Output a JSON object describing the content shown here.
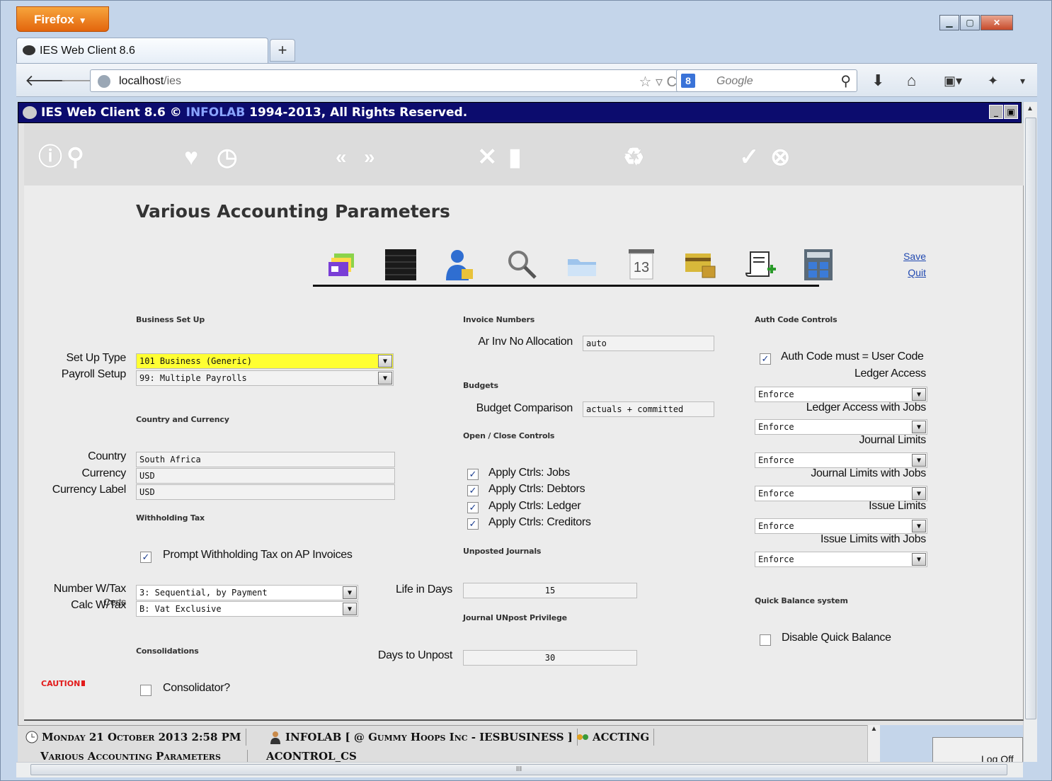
{
  "browser": {
    "menu_label": "Firefox",
    "tab_title": "IES Web Client 8.6",
    "new_tab": "+",
    "url_host": "localhost",
    "url_path": "/ies",
    "search_engine": "8",
    "search_placeholder": "Google"
  },
  "app": {
    "title_pre": "IES Web Client 8.6 © ",
    "title_brand": "INFOLAB",
    "title_post": " 1994-2013, All Rights Reserved.",
    "page_title": "Various Accounting Parameters",
    "save": "Save",
    "quit": "Quit"
  },
  "business": {
    "heading": "Business Set Up",
    "setup_type_label": "Set Up Type",
    "setup_type_value": "101 Business (Generic)",
    "payroll_label": "Payroll Setup",
    "payroll_value": "99: Multiple Payrolls"
  },
  "country": {
    "heading": "Country and Currency",
    "country_label": "Country",
    "country_value": "South Africa",
    "currency_label": "Currency",
    "currency_value": "USD",
    "currency_label_label": "Currency Label",
    "currency_label_value": "USD"
  },
  "wht": {
    "heading": "Withholding Tax",
    "prompt_label": "Prompt Withholding Tax on AP Invoices",
    "number_label": "Number W/Tax",
    "number_value": "3: Sequential, by Payment",
    "calc_label": "Calc W/Tax",
    "calc_value": "B: Vat Exclusive",
    "overlap_label": "Certs"
  },
  "consolidations": {
    "heading": "Consolidations",
    "caution": "CAUTION",
    "consolidator_label": "Consolidator?"
  },
  "invoice": {
    "heading": "Invoice Numbers",
    "ar_label": "Ar Inv No Allocation",
    "ar_value": "auto"
  },
  "budgets": {
    "heading": "Budgets",
    "comparison_label": "Budget Comparison",
    "comparison_value": "actuals + committed"
  },
  "openclose": {
    "heading": "Open / Close Controls",
    "items": [
      "Apply Ctrls: Jobs",
      "Apply Ctrls: Debtors",
      "Apply Ctrls: Ledger",
      "Apply Ctrls: Creditors"
    ]
  },
  "unposted": {
    "heading": "Unposted Journals",
    "life_label": "Life in Days",
    "life_value": "15"
  },
  "unpost": {
    "heading": "Journal UNpost Privilege",
    "days_label": "Days to Unpost",
    "days_value": "30"
  },
  "auth": {
    "heading": "Auth Code Controls",
    "must_label": "Auth Code must = User Code",
    "rows": [
      {
        "label": "Ledger Access",
        "value": "Enforce"
      },
      {
        "label": "Ledger Access with Jobs",
        "value": "Enforce"
      },
      {
        "label": "Journal Limits",
        "value": "Enforce"
      },
      {
        "label": "Journal Limits with Jobs",
        "value": "Enforce"
      },
      {
        "label": "Issue Limits",
        "value": "Enforce"
      },
      {
        "label": "Issue Limits with Jobs",
        "value": "Enforce"
      }
    ]
  },
  "quick": {
    "heading": "Quick Balance system",
    "disable_label": "Disable Quick Balance"
  },
  "status": {
    "datetime": "Monday 21 October 2013 2:58 PM",
    "company": "INFOLAB [ @ Gummy Hoops Inc - IESBUSINESS ]",
    "module": "ACCTING",
    "task1": "Various Accounting Parameters",
    "task2": "ACONTROL_CS",
    "logoff": "Log Off"
  }
}
